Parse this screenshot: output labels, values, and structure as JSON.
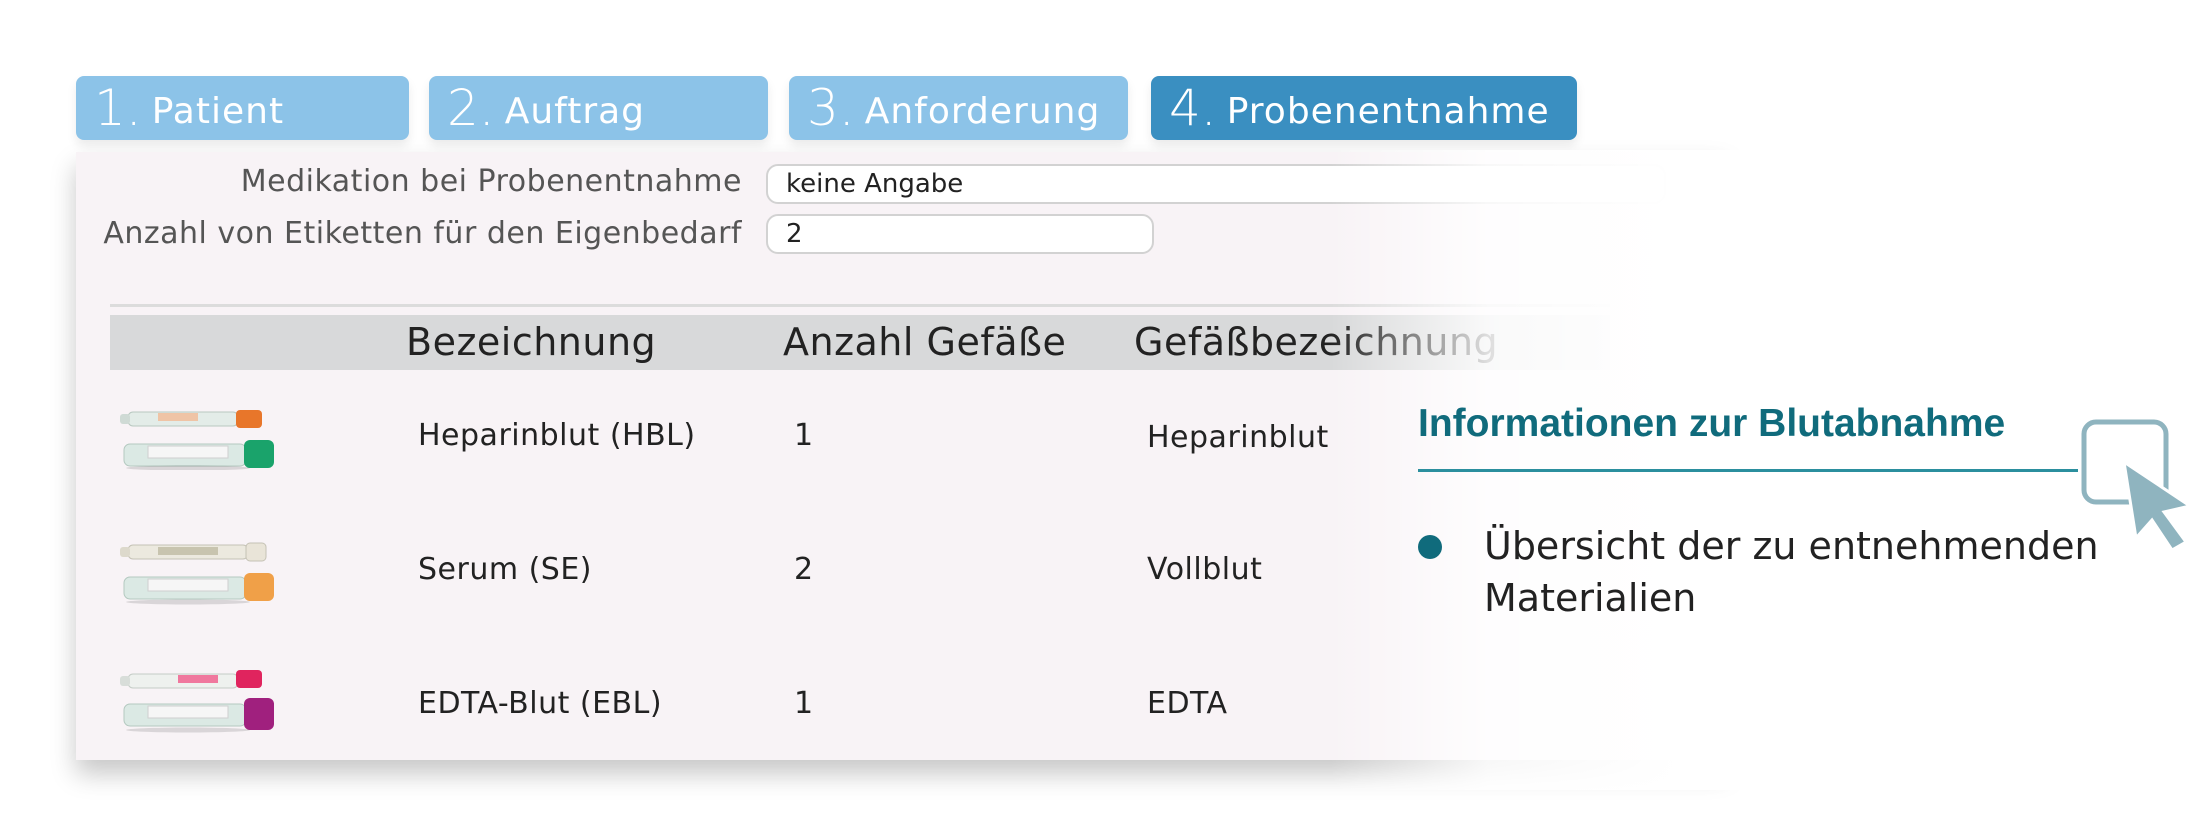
{
  "tabs": [
    {
      "num": "1.",
      "label": "Patient",
      "active": false
    },
    {
      "num": "2.",
      "label": "Auftrag",
      "active": false
    },
    {
      "num": "3.",
      "label": "Anforderung",
      "active": false
    },
    {
      "num": "4.",
      "label": "Probenentnahme",
      "active": true
    }
  ],
  "form": {
    "medication_label": "Medikation bei Probenentnahme",
    "medication_value": "keine Angabe",
    "labels_label": "Anzahl von Etiketten für den Eigenbedarf",
    "labels_value": "2"
  },
  "table": {
    "columns": [
      "Bezeichnung",
      "Anzahl Gefäße",
      "Gefäßbezeichnung"
    ],
    "rows": [
      {
        "name": "Heparinblut (HBL)",
        "count": "1",
        "container": "Heparinblut",
        "tube_icon": "heparin-tube-icon"
      },
      {
        "name": "Serum (SE)",
        "count": "2",
        "container": "Vollblut",
        "tube_icon": "serum-tube-icon"
      },
      {
        "name": "EDTA-Blut (EBL)",
        "count": "1",
        "container": "EDTA",
        "tube_icon": "edta-tube-icon"
      }
    ]
  },
  "info": {
    "title": "Informationen zur Blutabnahme",
    "bullets": [
      "Übersicht der zu entnehmenden Materialien"
    ]
  },
  "colors": {
    "tab": "#8cc3e8",
    "tab_active": "#3a8fc1",
    "accent": "#106b7c",
    "panel": "#f8f3f6"
  }
}
